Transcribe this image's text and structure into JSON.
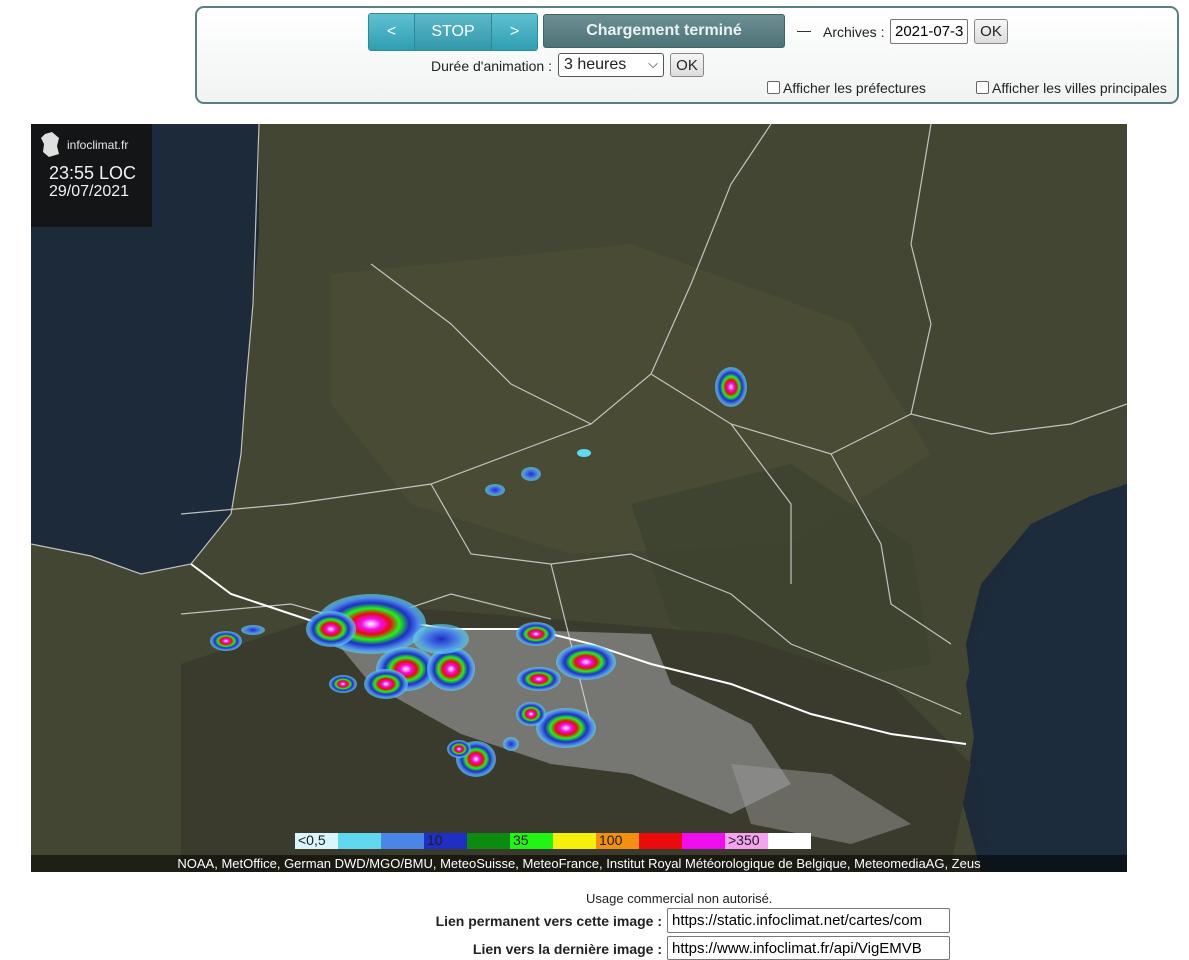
{
  "controls": {
    "prev_label": "<",
    "stop_label": "STOP",
    "next_label": ">",
    "status_label": "Chargement terminé",
    "dash": "—",
    "archives_label": "Archives :",
    "archives_value": "2021-07-3",
    "ok_label": "OK",
    "animation_label": "Durée d'animation :",
    "animation_value": "3 heures",
    "prefectures_label": "Afficher les préfectures",
    "villes_label": "Afficher les villes principales"
  },
  "map": {
    "brand": "infoclimat.fr",
    "time": "23:55 LOC",
    "date": "29/07/2021",
    "legend": [
      {
        "label": "<0,5",
        "color": "#d8f6fb"
      },
      {
        "label": "",
        "color": "#5fd9f0"
      },
      {
        "label": "",
        "color": "#4b85e8"
      },
      {
        "label": "10",
        "color": "#1f2fc4"
      },
      {
        "label": "",
        "color": "#0d8a10"
      },
      {
        "label": "35",
        "color": "#21f516"
      },
      {
        "label": "",
        "color": "#f4f00b"
      },
      {
        "label": "100",
        "color": "#f39012"
      },
      {
        "label": "",
        "color": "#ea0c0c"
      },
      {
        "label": "",
        "color": "#f00df0"
      },
      {
        "label": ">350",
        "color": "#f5a2f0"
      },
      {
        "label": "",
        "color": "#ffffff"
      }
    ],
    "credits": "NOAA, MetOffice, German DWD/MGO/BMU, MeteoSuisse, MeteoFrance, Institut Royal Météorologique de Belgique, MeteomediaAG, Zeus"
  },
  "footer": {
    "usage": "Usage commercial non autorisé.",
    "permalink_label": "Lien permanent vers cette image :",
    "permalink_value": "https://static.infoclimat.net/cartes/com",
    "latest_label": "Lien vers la dernière image :",
    "latest_value": "https://www.infoclimat.fr/api/VigEMVB"
  }
}
